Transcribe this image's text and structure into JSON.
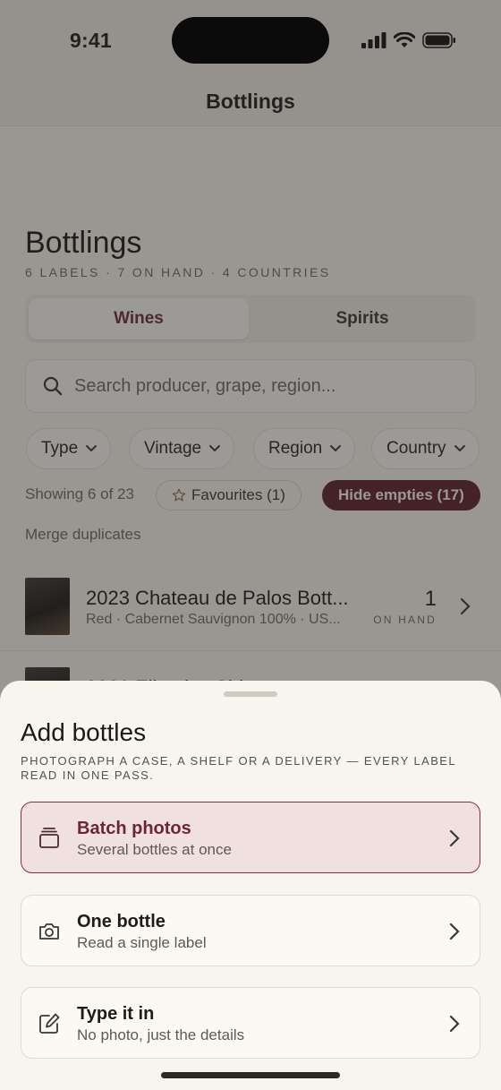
{
  "status_bar": {
    "time": "9:41"
  },
  "nav": {
    "title": "Bottlings"
  },
  "header": {
    "title": "Bottlings",
    "subtitle": "6 LABELS · 7 ON HAND · 4 COUNTRIES"
  },
  "segments": {
    "wines": "Wines",
    "spirits": "Spirits",
    "selected": "Wines"
  },
  "search": {
    "placeholder": "Search producer, grape, region..."
  },
  "filters": {
    "type": "Type",
    "vintage": "Vintage",
    "region": "Region",
    "country": "Country"
  },
  "summary": {
    "showing": "Showing 6 of 23",
    "favourites": "Favourites (1)",
    "hide_empties": "Hide empties (17)",
    "merge": "Merge duplicates"
  },
  "list": {
    "items": [
      {
        "title": "2023 Chateau de Palos Bott...",
        "subtitle": "Red · Cabernet Sauvignon 100% · US...",
        "count": "1",
        "count_label": "ON HAND"
      },
      {
        "title": "2021 Ellersley Shiraz",
        "subtitle": "",
        "count": "",
        "count_label": ""
      }
    ]
  },
  "sheet": {
    "title": "Add bottles",
    "subtitle": "PHOTOGRAPH A CASE, A SHELF OR A DELIVERY — EVERY LABEL READ IN ONE PASS.",
    "options": [
      {
        "title": "Batch photos",
        "subtitle": "Several bottles at once",
        "icon": "stack-icon",
        "selected": true
      },
      {
        "title": "One bottle",
        "subtitle": "Read a single label",
        "icon": "camera-icon",
        "selected": false
      },
      {
        "title": "Type it in",
        "subtitle": "No photo, just the details",
        "icon": "edit-icon",
        "selected": false
      }
    ]
  },
  "colors": {
    "accent": "#5e1f2c",
    "accent_text": "#6a2735",
    "selected_option_bg": "#f0e1df",
    "background": "#f8f5ee"
  }
}
